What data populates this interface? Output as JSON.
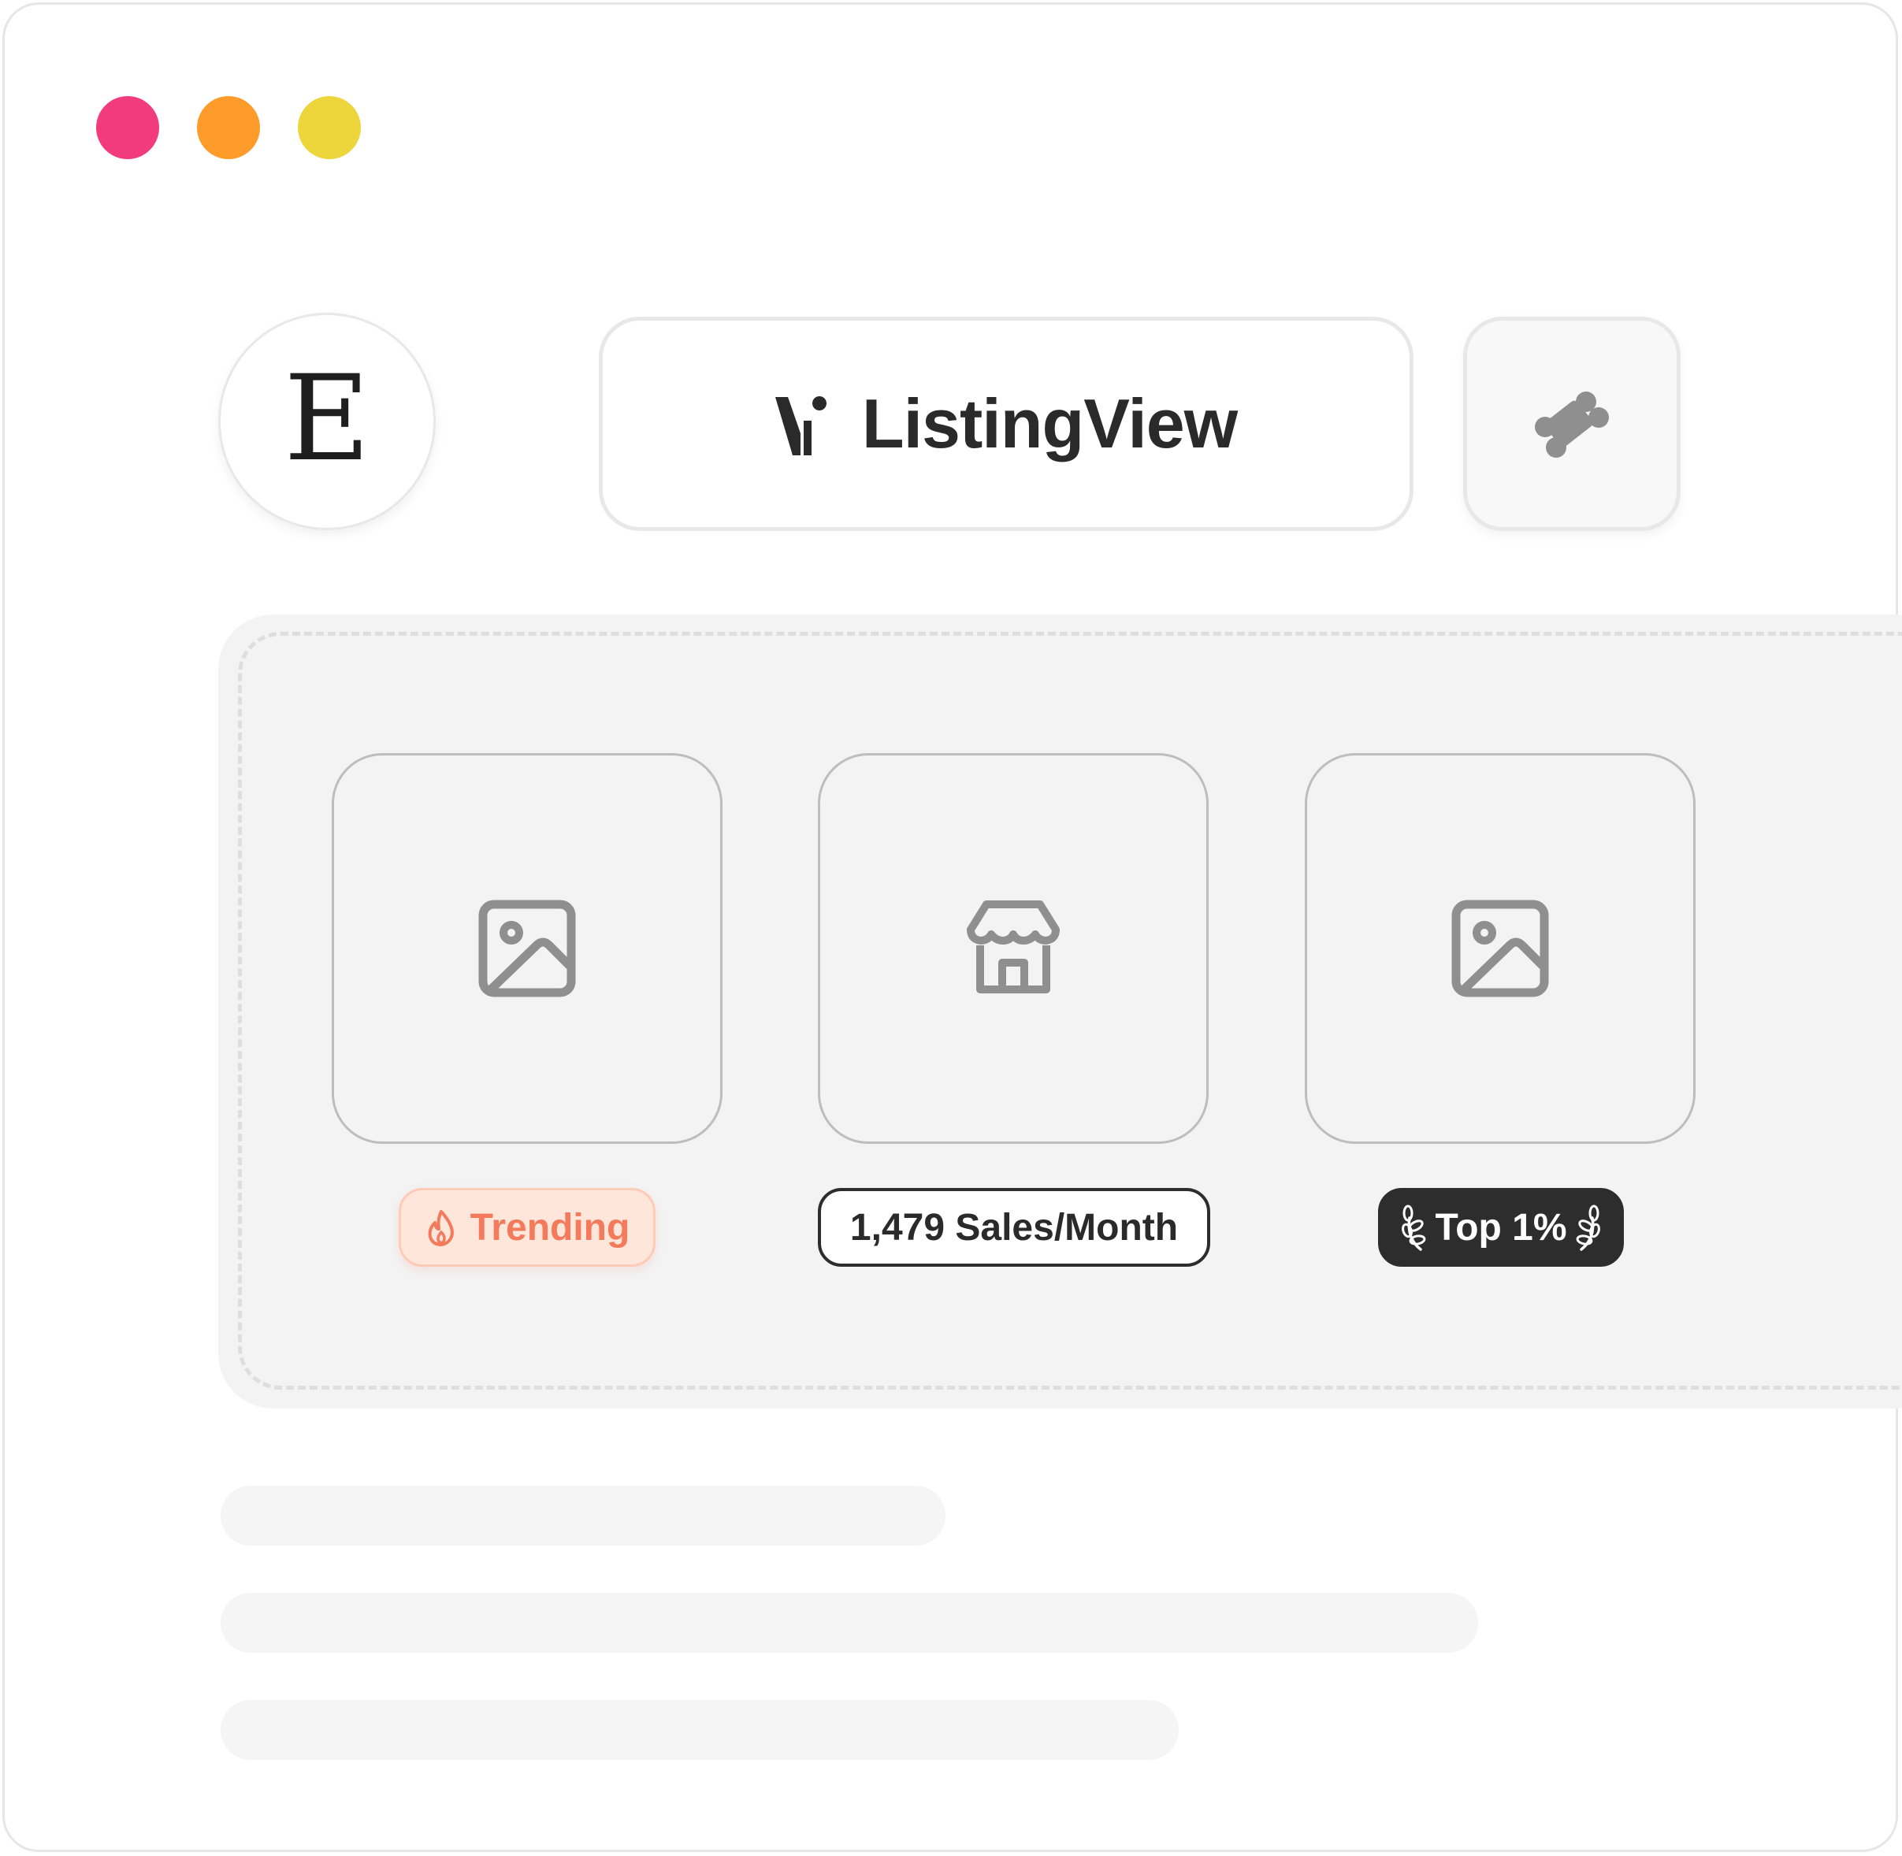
{
  "window": {
    "controls": {
      "close_color": "#f13b7d",
      "minimize_color": "#fd9c2a",
      "maximize_color": "#ecd63b"
    }
  },
  "header": {
    "logo_letter": "E",
    "app_name": "ListingView",
    "plugin_icon": "puzzle-piece-icon"
  },
  "cards": [
    {
      "icon": "image-icon",
      "badge_icon": "flame-icon",
      "badge_label": "Trending"
    },
    {
      "icon": "storefront-icon",
      "badge_label": "1,479 Sales/Month"
    },
    {
      "icon": "image-icon",
      "badge_icon": "laurel-icon",
      "badge_label": "Top 1%"
    }
  ],
  "colors": {
    "accent_trending": "#f47a5c",
    "badge_dark": "#2d2d2d",
    "icon_gray": "#8f8f8f"
  }
}
